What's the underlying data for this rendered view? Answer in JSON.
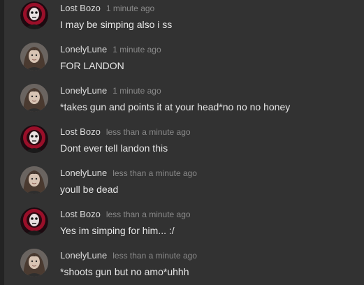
{
  "messages": [
    {
      "author": "Lost Bozo",
      "time": "1 minute ago",
      "text": "I may be simping also i ss",
      "avatar_icon": "masked-figure-avatar-icon"
    },
    {
      "author": "LonelyLune",
      "time": "1 minute ago",
      "text": "FOR LANDON",
      "avatar_icon": "woman-portrait-avatar-icon"
    },
    {
      "author": "LonelyLune",
      "time": "1 minute ago",
      "text": "*takes gun and points it at your head*no no no honey",
      "avatar_icon": "woman-portrait-avatar-icon"
    },
    {
      "author": "Lost Bozo",
      "time": "less than a minute ago",
      "text": "Dont ever tell landon this",
      "avatar_icon": "masked-figure-avatar-icon"
    },
    {
      "author": "LonelyLune",
      "time": "less than a minute ago",
      "text": "youll be dead",
      "avatar_icon": "woman-portrait-avatar-icon"
    },
    {
      "author": "Lost Bozo",
      "time": "less than a minute ago",
      "text": "Yes im simping for him... :/",
      "avatar_icon": "masked-figure-avatar-icon"
    },
    {
      "author": "LonelyLune",
      "time": "less than a minute ago",
      "text": "*shoots gun but no amo*uhhh",
      "avatar_icon": "woman-portrait-avatar-icon"
    }
  ],
  "colors": {
    "background": "#323232",
    "author": "#dcdcdc",
    "timestamp": "#8a8a8a",
    "message_text": "#e6e6e6",
    "bozo_glow": "#d0103a"
  }
}
